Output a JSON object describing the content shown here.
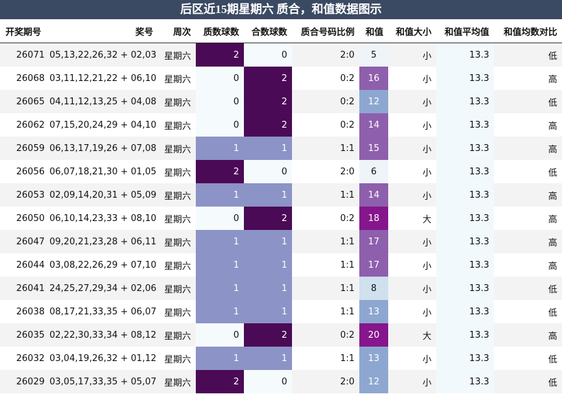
{
  "title": "后区近15期星期六 质合，和值数据图示",
  "columns": [
    "开奖期号",
    "奖号",
    "周次",
    "质数球数",
    "合数球数",
    "质合号码比例",
    "和值",
    "和值大小",
    "和值平均值",
    "和值均数对比"
  ],
  "colors": {
    "title_bg": "#3b4a63",
    "prime_2": "#4b0a55",
    "prime_1": "#8c93c6",
    "prime_0": "#f5fbfd",
    "sum_high": "#86168c",
    "sum_mid": "#8e5fad",
    "sum_low": "#8ea7d0",
    "sum_light": "#cfe0ee",
    "sum_pale": "#eef4f8"
  },
  "rows": [
    {
      "period": "26071",
      "numbers": "05,13,22,26,32 + 02,03",
      "weekday": "星期六",
      "prime": "2",
      "composite": "0",
      "ratio": "2:0",
      "sum": "5",
      "size": "小",
      "avg": "13.3",
      "cmp": "低"
    },
    {
      "period": "26068",
      "numbers": "03,11,12,21,22 + 06,10",
      "weekday": "星期六",
      "prime": "0",
      "composite": "2",
      "ratio": "0:2",
      "sum": "16",
      "size": "小",
      "avg": "13.3",
      "cmp": "高"
    },
    {
      "period": "26065",
      "numbers": "04,11,12,13,25 + 04,08",
      "weekday": "星期六",
      "prime": "0",
      "composite": "2",
      "ratio": "0:2",
      "sum": "12",
      "size": "小",
      "avg": "13.3",
      "cmp": "低"
    },
    {
      "period": "26062",
      "numbers": "07,15,20,24,29 + 04,10",
      "weekday": "星期六",
      "prime": "0",
      "composite": "2",
      "ratio": "0:2",
      "sum": "14",
      "size": "小",
      "avg": "13.3",
      "cmp": "高"
    },
    {
      "period": "26059",
      "numbers": "06,13,17,19,26 + 07,08",
      "weekday": "星期六",
      "prime": "1",
      "composite": "1",
      "ratio": "1:1",
      "sum": "15",
      "size": "小",
      "avg": "13.3",
      "cmp": "高"
    },
    {
      "period": "26056",
      "numbers": "06,07,18,21,30 + 01,05",
      "weekday": "星期六",
      "prime": "2",
      "composite": "0",
      "ratio": "2:0",
      "sum": "6",
      "size": "小",
      "avg": "13.3",
      "cmp": "低"
    },
    {
      "period": "26053",
      "numbers": "02,09,14,20,31 + 05,09",
      "weekday": "星期六",
      "prime": "1",
      "composite": "1",
      "ratio": "1:1",
      "sum": "14",
      "size": "小",
      "avg": "13.3",
      "cmp": "高"
    },
    {
      "period": "26050",
      "numbers": "06,10,14,23,33 + 08,10",
      "weekday": "星期六",
      "prime": "0",
      "composite": "2",
      "ratio": "0:2",
      "sum": "18",
      "size": "大",
      "avg": "13.3",
      "cmp": "高"
    },
    {
      "period": "26047",
      "numbers": "09,20,21,23,28 + 06,11",
      "weekday": "星期六",
      "prime": "1",
      "composite": "1",
      "ratio": "1:1",
      "sum": "17",
      "size": "小",
      "avg": "13.3",
      "cmp": "高"
    },
    {
      "period": "26044",
      "numbers": "03,08,22,26,29 + 07,10",
      "weekday": "星期六",
      "prime": "1",
      "composite": "1",
      "ratio": "1:1",
      "sum": "17",
      "size": "小",
      "avg": "13.3",
      "cmp": "高"
    },
    {
      "period": "26041",
      "numbers": "24,25,27,29,34 + 02,06",
      "weekday": "星期六",
      "prime": "1",
      "composite": "1",
      "ratio": "1:1",
      "sum": "8",
      "size": "小",
      "avg": "13.3",
      "cmp": "低"
    },
    {
      "period": "26038",
      "numbers": "08,17,21,33,35 + 06,07",
      "weekday": "星期六",
      "prime": "1",
      "composite": "1",
      "ratio": "1:1",
      "sum": "13",
      "size": "小",
      "avg": "13.3",
      "cmp": "低"
    },
    {
      "period": "26035",
      "numbers": "02,22,30,33,34 + 08,12",
      "weekday": "星期六",
      "prime": "0",
      "composite": "2",
      "ratio": "0:2",
      "sum": "20",
      "size": "大",
      "avg": "13.3",
      "cmp": "高"
    },
    {
      "period": "26032",
      "numbers": "03,04,19,26,32 + 01,12",
      "weekday": "星期六",
      "prime": "1",
      "composite": "1",
      "ratio": "1:1",
      "sum": "13",
      "size": "小",
      "avg": "13.3",
      "cmp": "低"
    },
    {
      "period": "26029",
      "numbers": "03,05,17,33,35 + 05,07",
      "weekday": "星期六",
      "prime": "2",
      "composite": "0",
      "ratio": "2:0",
      "sum": "12",
      "size": "小",
      "avg": "13.3",
      "cmp": "低"
    }
  ]
}
